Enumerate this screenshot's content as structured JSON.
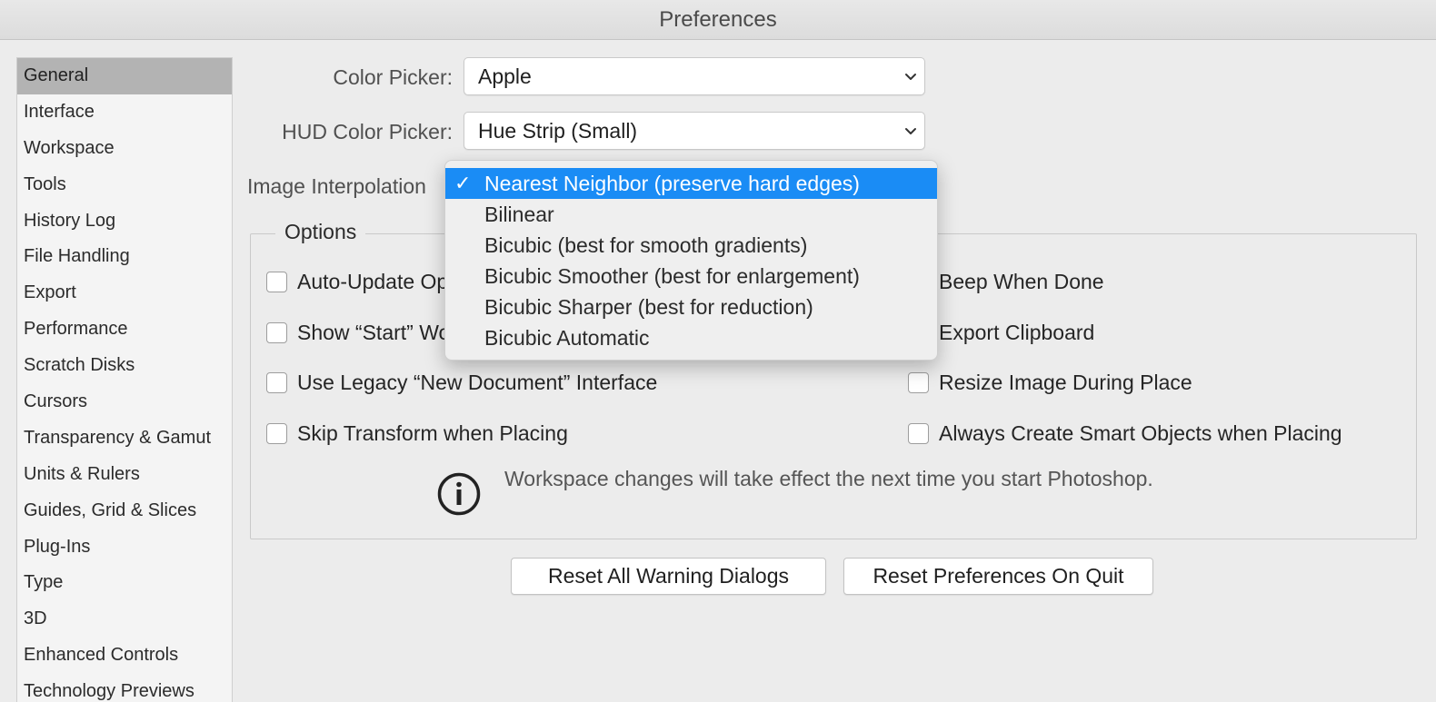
{
  "window": {
    "title": "Preferences"
  },
  "sidebar": {
    "items": [
      {
        "label": "General",
        "selected": true
      },
      {
        "label": "Interface"
      },
      {
        "label": "Workspace"
      },
      {
        "label": "Tools"
      },
      {
        "label": "History Log"
      },
      {
        "label": "File Handling"
      },
      {
        "label": "Export"
      },
      {
        "label": "Performance"
      },
      {
        "label": "Scratch Disks"
      },
      {
        "label": "Cursors"
      },
      {
        "label": "Transparency & Gamut"
      },
      {
        "label": "Units & Rulers"
      },
      {
        "label": "Guides, Grid & Slices"
      },
      {
        "label": "Plug-Ins"
      },
      {
        "label": "Type"
      },
      {
        "label": "3D"
      },
      {
        "label": "Enhanced Controls"
      },
      {
        "label": "Technology Previews"
      }
    ]
  },
  "general": {
    "color_picker": {
      "label": "Color Picker:",
      "value": "Apple"
    },
    "hud_color_picker": {
      "label": "HUD Color Picker:",
      "value": "Hue Strip (Small)"
    },
    "image_interpolation": {
      "label": "Image Interpolation",
      "options": [
        "Nearest Neighbor (preserve hard edges)",
        "Bilinear",
        "Bicubic (best for smooth gradients)",
        "Bicubic Smoother (best for enlargement)",
        "Bicubic Sharper (best for reduction)",
        "Bicubic Automatic"
      ],
      "selected_index": 0,
      "check_glyph": "✓"
    }
  },
  "options": {
    "legend": "Options",
    "left": [
      {
        "label": "Auto-Update Open Documents",
        "checked": false
      },
      {
        "label": "Show “Start” Workspace When No Documents Are Open",
        "checked": false
      },
      {
        "label": "Use Legacy “New Document” Interface",
        "checked": false
      },
      {
        "label": "Skip Transform when Placing",
        "checked": false
      }
    ],
    "right": [
      {
        "label": "Beep When Done",
        "checked": false
      },
      {
        "label": "Export Clipboard",
        "checked": false
      },
      {
        "label": "Resize Image During Place",
        "checked": false
      },
      {
        "label": "Always Create Smart Objects when Placing",
        "checked": false
      }
    ],
    "info_text": "Workspace changes will take effect the next time you start Photoshop."
  },
  "buttons": {
    "reset_warnings": "Reset All Warning Dialogs",
    "reset_prefs": "Reset Preferences On Quit"
  },
  "colors": {
    "selection_blue": "#1a8cf5",
    "sidebar_selected": "#b3b3b3",
    "window_bg": "#ececec"
  }
}
